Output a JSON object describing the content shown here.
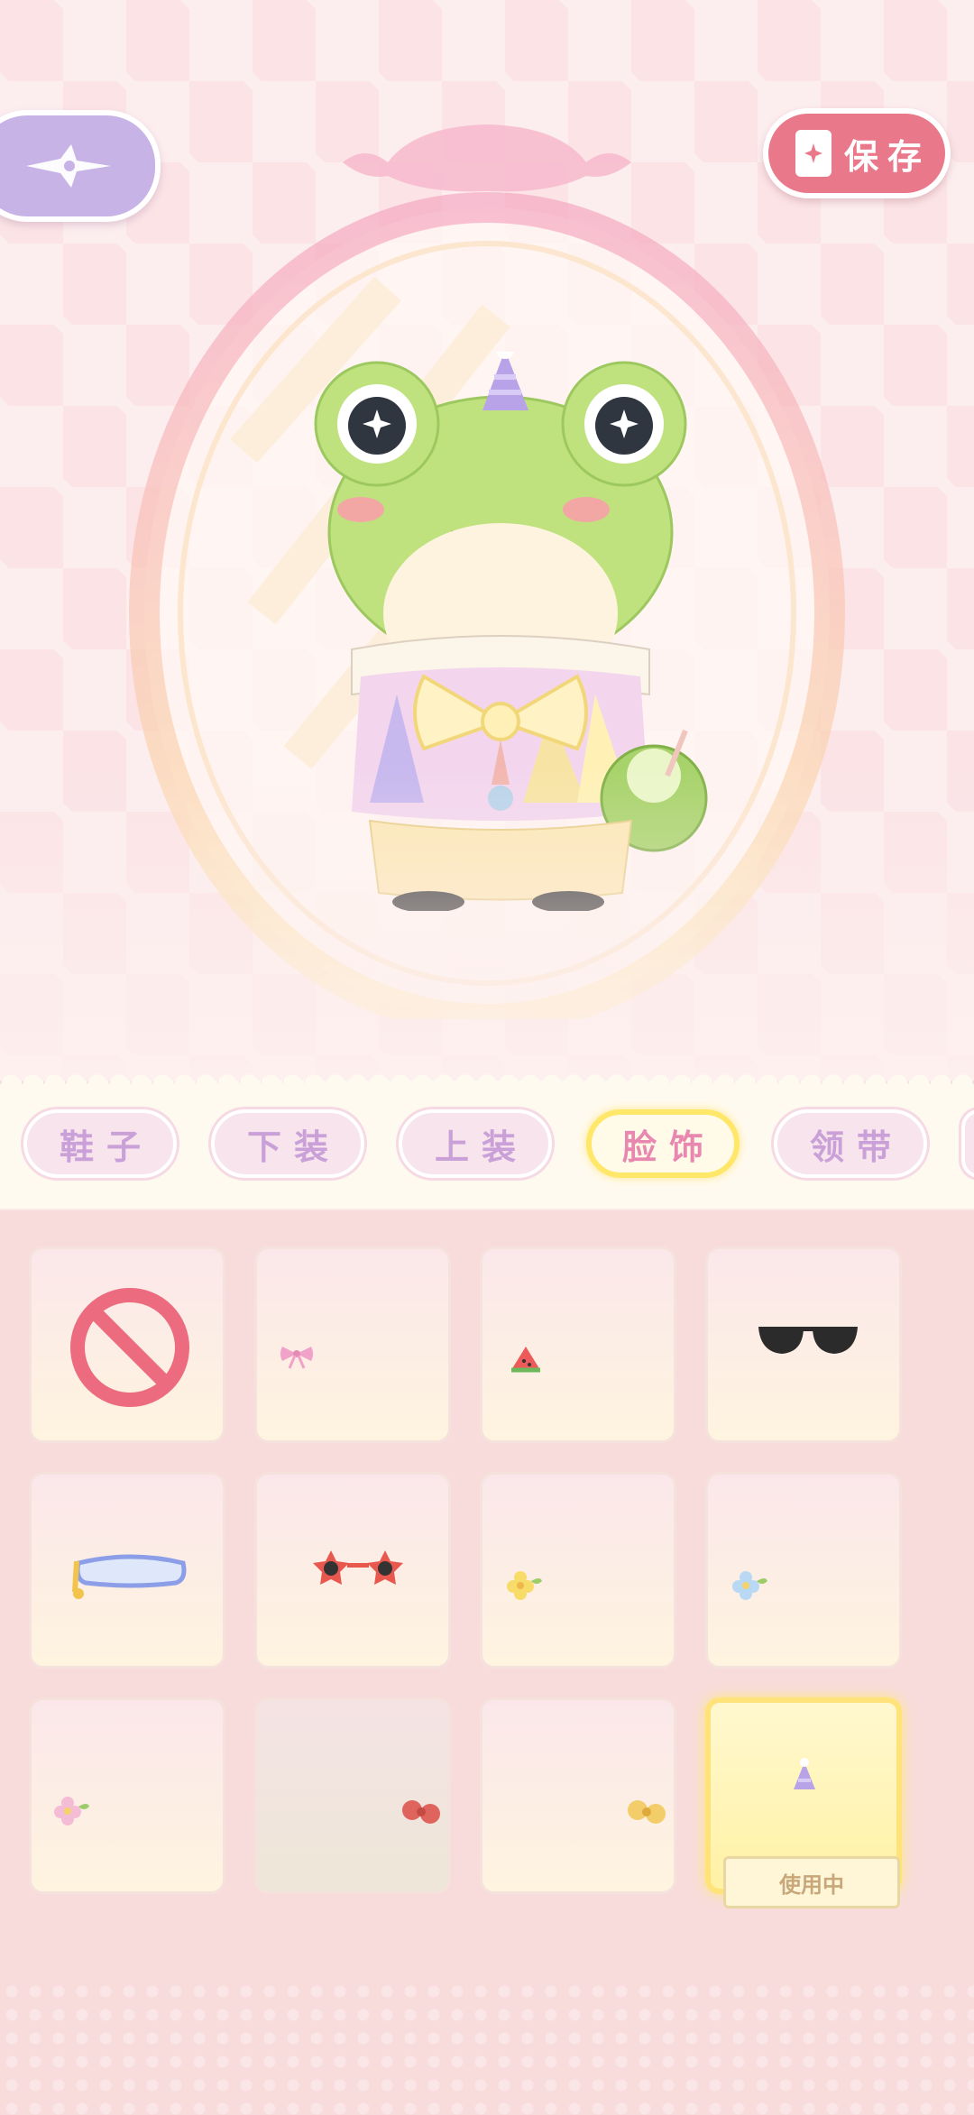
{
  "header": {
    "back_icon": "compass-star-icon",
    "save_label": "保存",
    "save_icon": "document-sparkle-icon"
  },
  "tabs": [
    {
      "label": "鞋子",
      "active": false
    },
    {
      "label": "下装",
      "active": false
    },
    {
      "label": "上装",
      "active": false
    },
    {
      "label": "脸饰",
      "active": true
    },
    {
      "label": "领带",
      "active": false
    }
  ],
  "items": [
    {
      "icon": "none-prohibited-icon"
    },
    {
      "icon": "pink-bow-icon"
    },
    {
      "icon": "watermelon-slice-icon"
    },
    {
      "icon": "black-sunglasses-icon"
    },
    {
      "icon": "blue-goggles-icon"
    },
    {
      "icon": "star-sunglasses-icon"
    },
    {
      "icon": "yellow-flower-icon"
    },
    {
      "icon": "blue-flower-icon"
    },
    {
      "icon": "pink-flower-icon"
    },
    {
      "icon": "red-bow-icon"
    },
    {
      "icon": "yellow-bow-icon"
    },
    {
      "icon": "party-hat-icon",
      "badge": "使用中"
    }
  ],
  "colors": {
    "accent_pink": "#e9798a",
    "back_purple": "#c8b3e6",
    "active_yellow": "#ffe76a",
    "tab_text": "#c9a1d8"
  }
}
